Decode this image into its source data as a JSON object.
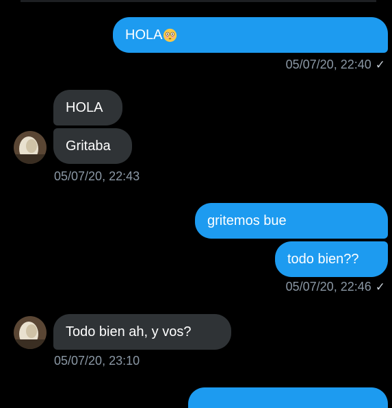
{
  "colors": {
    "background": "#000000",
    "outgoing_bubble": "#1d9bf0",
    "incoming_bubble": "#2f3336",
    "timestamp": "#8b98a5"
  },
  "messages": [
    {
      "id": "m1",
      "direction": "outgoing",
      "text": "HOLA",
      "emoji": "flushed-face-icon"
    },
    {
      "id": "m2",
      "direction": "incoming",
      "text": "HOLA"
    },
    {
      "id": "m3",
      "direction": "incoming",
      "text": "Gritaba"
    },
    {
      "id": "m4",
      "direction": "outgoing",
      "text": "gritemos bue"
    },
    {
      "id": "m5",
      "direction": "outgoing",
      "text": "todo bien??"
    },
    {
      "id": "m6",
      "direction": "incoming",
      "text": "Todo bien ah, y vos?"
    }
  ],
  "timestamps": {
    "t1": "05/07/20, 22:40",
    "t2": "05/07/20, 22:43",
    "t3": "05/07/20, 22:46",
    "t4": "05/07/20, 23:10"
  },
  "read_receipt": "✓"
}
